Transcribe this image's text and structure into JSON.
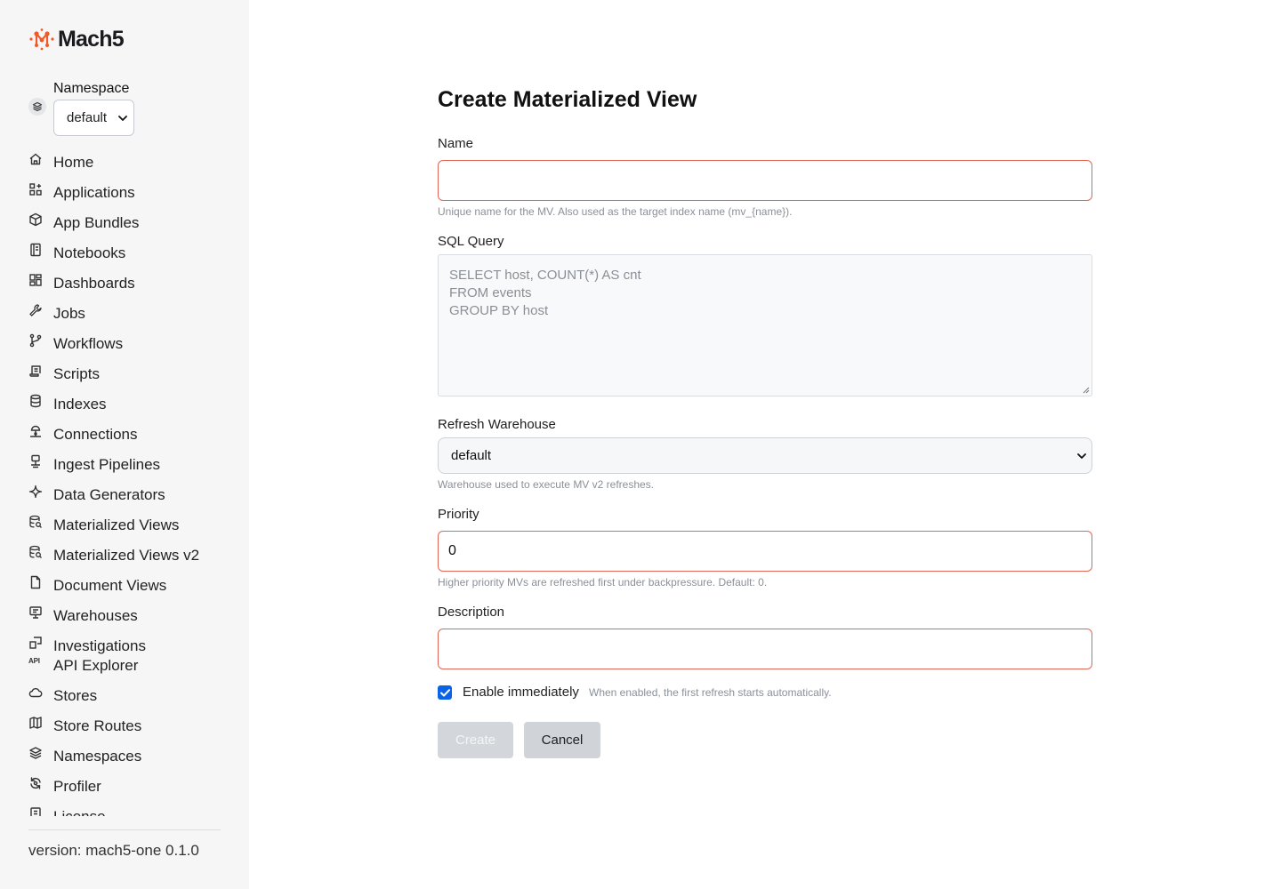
{
  "brand": {
    "name": "Mach5",
    "accent": "#f05a28"
  },
  "namespace": {
    "label": "Namespace",
    "selected": "default"
  },
  "nav": {
    "items": [
      {
        "label": "Home",
        "icon": "home-icon"
      },
      {
        "label": "Applications",
        "icon": "apps-grid-icon"
      },
      {
        "label": "App Bundles",
        "icon": "package-icon"
      },
      {
        "label": "Notebooks",
        "icon": "notebook-icon"
      },
      {
        "label": "Dashboards",
        "icon": "dashboard-icon"
      },
      {
        "label": "Jobs",
        "icon": "wrench-icon"
      },
      {
        "label": "Workflows",
        "icon": "git-branch-icon"
      },
      {
        "label": "Scripts",
        "icon": "scroll-icon"
      },
      {
        "label": "Indexes",
        "icon": "database-icon"
      },
      {
        "label": "Connections",
        "icon": "network-icon"
      },
      {
        "label": "Ingest Pipelines",
        "icon": "pipeline-icon"
      },
      {
        "label": "Data Generators",
        "icon": "sparkle-icon"
      },
      {
        "label": "Materialized Views",
        "icon": "database-search-icon"
      },
      {
        "label": "Materialized Views v2",
        "icon": "database-search-icon"
      },
      {
        "label": "Document Views",
        "icon": "file-icon"
      },
      {
        "label": "Warehouses",
        "icon": "monitor-icon"
      },
      {
        "label": "Investigations",
        "icon": "investigation-icon"
      },
      {
        "label": "API Explorer",
        "icon": "api-icon",
        "icon_text": "API"
      },
      {
        "label": "Stores",
        "icon": "cloud-icon"
      },
      {
        "label": "Store Routes",
        "icon": "map-icon"
      },
      {
        "label": "Namespaces",
        "icon": "layers-icon"
      },
      {
        "label": "Profiler",
        "icon": "refresh-icon"
      },
      {
        "label": "License",
        "icon": "license-icon"
      }
    ]
  },
  "footer": {
    "version": "version: mach5-one 0.1.0"
  },
  "form": {
    "title": "Create Materialized View",
    "name": {
      "label": "Name",
      "value": "",
      "help": "Unique name for the MV. Also used as the target index name (mv_{name})."
    },
    "sql": {
      "label": "SQL Query",
      "placeholder": "SELECT host, COUNT(*) AS cnt\nFROM events\nGROUP BY host"
    },
    "warehouse": {
      "label": "Refresh Warehouse",
      "selected": "default",
      "help": "Warehouse used to execute MV v2 refreshes."
    },
    "priority": {
      "label": "Priority",
      "value": "0",
      "help": "Higher priority MVs are refreshed first under backpressure. Default: 0."
    },
    "description": {
      "label": "Description",
      "value": ""
    },
    "enable": {
      "label": "Enable immediately",
      "checked": true,
      "help": "When enabled, the first refresh starts automatically."
    },
    "buttons": {
      "create": "Create",
      "cancel": "Cancel"
    }
  },
  "colors": {
    "error_border": "#e06655",
    "checkbox": "#0b63e5",
    "sidebar_bg": "#f6f6f7"
  }
}
